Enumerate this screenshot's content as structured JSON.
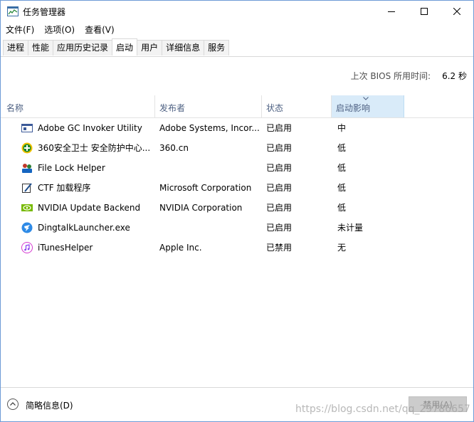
{
  "window": {
    "title": "任务管理器",
    "controls": {
      "minimize": "minimize-icon",
      "maximize": "maximize-icon",
      "close": "close-icon"
    }
  },
  "menu": [
    "文件(F)",
    "选项(O)",
    "查看(V)"
  ],
  "tabs": [
    {
      "label": "进程",
      "active": false
    },
    {
      "label": "性能",
      "active": false
    },
    {
      "label": "应用历史记录",
      "active": false
    },
    {
      "label": "启动",
      "active": true
    },
    {
      "label": "用户",
      "active": false
    },
    {
      "label": "详细信息",
      "active": false
    },
    {
      "label": "服务",
      "active": false
    }
  ],
  "bios": {
    "label": "上次 BIOS 所用时间:",
    "value": "6.2 秒"
  },
  "columns": [
    "名称",
    "发布者",
    "状态",
    "启动影响"
  ],
  "rows": [
    {
      "icon": "adobe-gc-icon",
      "name": "Adobe GC Invoker Utility",
      "publisher": "Adobe Systems, Incor...",
      "status": "已启用",
      "impact": "中"
    },
    {
      "icon": "360-safe-icon",
      "name": "360安全卫士 安全防护中心...",
      "publisher": "360.cn",
      "status": "已启用",
      "impact": "低"
    },
    {
      "icon": "file-lock-icon",
      "name": "File Lock Helper",
      "publisher": "",
      "status": "已启用",
      "impact": "低"
    },
    {
      "icon": "ctf-icon",
      "name": "CTF 加载程序",
      "publisher": "Microsoft Corporation",
      "status": "已启用",
      "impact": "低"
    },
    {
      "icon": "nvidia-icon",
      "name": "NVIDIA Update Backend",
      "publisher": "NVIDIA Corporation",
      "status": "已启用",
      "impact": "低"
    },
    {
      "icon": "dingtalk-icon",
      "name": "DingtalkLauncher.exe",
      "publisher": "",
      "status": "已启用",
      "impact": "未计量"
    },
    {
      "icon": "itunes-icon",
      "name": "iTunesHelper",
      "publisher": "Apple Inc.",
      "status": "已禁用",
      "impact": "无"
    }
  ],
  "footer": {
    "collapse_label": "简略信息(D)",
    "disable_button": "禁用(A)",
    "watermark": "https://blog.csdn.net/qq_29786657"
  },
  "colors": {
    "header_text": "#4d6082",
    "sorted_column_bg": "#d9ebf9",
    "window_border": "#6d9bd6",
    "disabled_button_bg": "#cccccc"
  }
}
